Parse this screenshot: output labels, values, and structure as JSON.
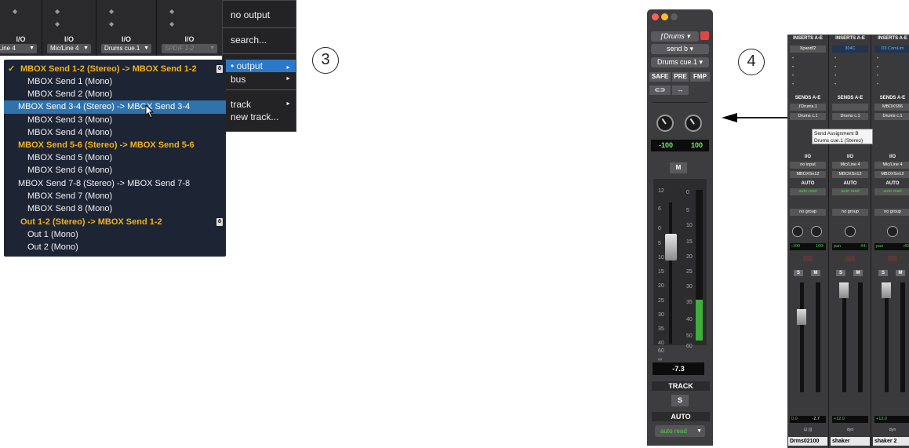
{
  "panel3": {
    "io_columns": [
      {
        "label": "I/O",
        "selector": "Line 4"
      },
      {
        "label": "I/O",
        "selector": "Mic/Line 4"
      },
      {
        "label": "I/O",
        "selector": "Drums cue.1"
      },
      {
        "label": "I/O",
        "selector": "SPDIF 1-2"
      }
    ],
    "submenu": {
      "items": [
        {
          "label": "no output"
        },
        {
          "label": "search..."
        },
        {
          "label": "• output"
        },
        {
          "label": "bus"
        },
        {
          "label": "track"
        },
        {
          "label": "new track..."
        }
      ]
    },
    "route_menu": {
      "items": [
        {
          "label": "MBOX Send 1-2 (Stereo) -> MBOX Send 1-2",
          "kind": "bus",
          "checked": true,
          "badge": true
        },
        {
          "label": "MBOX Send 1 (Mono)",
          "kind": "sub"
        },
        {
          "label": "MBOX Send 2 (Mono)",
          "kind": "sub"
        },
        {
          "label": "MBOX Send 3-4 (Stereo) -> MBOX Send 3-4",
          "kind": "highlight"
        },
        {
          "label": "MBOX Send 3 (Mono)",
          "kind": "sub"
        },
        {
          "label": "MBOX Send 4 (Mono)",
          "kind": "sub"
        },
        {
          "label": "MBOX Send 5-6 (Stereo) -> MBOX Send 5-6",
          "kind": "bus"
        },
        {
          "label": "MBOX Send 5 (Mono)",
          "kind": "sub"
        },
        {
          "label": "MBOX Send 6 (Mono)",
          "kind": "sub"
        },
        {
          "label": "MBOX Send 7-8 (Stereo) -> MBOX Send 7-8",
          "kind": "plain"
        },
        {
          "label": "MBOX Send 7 (Mono)",
          "kind": "sub"
        },
        {
          "label": "MBOX Send 8 (Mono)",
          "kind": "sub"
        },
        {
          "label": "Out 1-2 (Stereo) -> MBOX Send 1-2",
          "kind": "bus",
          "badge": true
        },
        {
          "label": "Out 1 (Mono)",
          "kind": "sub"
        },
        {
          "label": "Out 2 (Mono)",
          "kind": "sub"
        }
      ]
    },
    "step_number": "3"
  },
  "panel4": {
    "step_number": "4",
    "output_window": {
      "track": "ƒDrums",
      "send": "send b",
      "destination": "Drums cue.1",
      "safe": "SAFE",
      "pre": "PRE",
      "fmp": "FMP",
      "pan_left": "-100",
      "pan_right": "100",
      "mute": "M",
      "level": "-7.3",
      "section_track": "TRACK",
      "solo": "S",
      "section_auto": "AUTO",
      "auto_mode": "auto read",
      "scale_left": [
        "12",
        "6",
        "0",
        "5",
        "10",
        "15",
        "20",
        "25",
        "30",
        "35",
        "40",
        "60",
        "∞"
      ],
      "scale_right": [
        "0",
        "5",
        "10",
        "15",
        "20",
        "25",
        "30",
        "35",
        "40",
        "50",
        "60"
      ],
      "meter_level": 0.27
    },
    "strips": [
      {
        "insert_header": "INSERTS A-E",
        "insert1": "Xpand!2",
        "sends_header": "SENDS A-E",
        "send1": "ƒDrums.1",
        "send2": "Drums c.1",
        "io": "I/O",
        "input": "no input",
        "output": "MBOXSn12",
        "auto": "AUTO",
        "auto_mode": "auto read",
        "group": "no group",
        "pan_l": "‹100",
        "pan_r": "100›",
        "solo": "S",
        "mute": "M",
        "vol": "0.0",
        "peak": "-2.7",
        "name": "Drms02100"
      },
      {
        "insert_header": "INSERTS A-E",
        "insert1": "304C",
        "sends_header": "SENDS A-E",
        "send1": "",
        "send2": "Drums c.1",
        "io": "I/O",
        "input": "Mic/Line 4",
        "output": "MBOXSn12",
        "auto": "AUTO",
        "auto_mode": "auto read",
        "group": "no group",
        "pan_l": "pan",
        "pan_r": "44›",
        "solo": "S",
        "mute": "M",
        "vol": "+12.0",
        "peak": "",
        "dyn": "dyn",
        "name": "shaker"
      },
      {
        "insert_header": "INSERTS A-E",
        "insert1": "D3 ComLim",
        "sends_header": "SENDS A-E",
        "send1": "MBOXS56",
        "send2": "Drums c.1",
        "io": "I/O",
        "input": "Mic/Line 4",
        "output": "MBOXSn12",
        "auto": "AUTO",
        "auto_mode": "auto read",
        "group": "no group",
        "pan_l": "pan",
        "pan_r": "‹40",
        "solo": "S",
        "mute": "M",
        "vol": "+12.0",
        "peak": "",
        "dyn": "dyn",
        "name": "shaker 2"
      }
    ],
    "tooltip": {
      "line1": "Send Assignment B",
      "line2": "Drums cue.1 (Stereo)"
    }
  }
}
